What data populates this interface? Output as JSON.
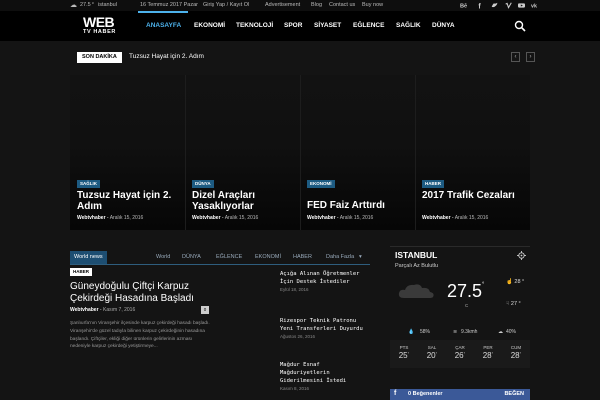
{
  "topbar": {
    "weather_temp": "27.5",
    "weather_unit": "c",
    "city": "istanbul",
    "date": "16 Temmuz 2017 Pazar",
    "links": [
      "Giriş Yap / Kayıt Ol",
      "Advertisement",
      "Blog",
      "Contact us",
      "Buy now"
    ],
    "social_icons": [
      "behance-icon",
      "facebook-icon",
      "twitter-icon",
      "vimeo-icon",
      "youtube-icon",
      "vk-icon"
    ]
  },
  "logo": {
    "line1": "WEB",
    "line2": "TV HABER"
  },
  "nav": {
    "items": [
      "ANASAYFA",
      "EKONOMİ",
      "TEKNOLOJİ",
      "SPOR",
      "SİYASET",
      "EĞLENCE",
      "SAĞLIK",
      "DÜNYA"
    ],
    "active": "ANASAYFA"
  },
  "breaking": {
    "tag": "SON DAKİKA",
    "headline": "Tuzsuz Hayat için 2. Adım",
    "prev_arrow": "‹",
    "next_arrow": "›"
  },
  "hero_tiles": [
    {
      "category": "SAĞLIK",
      "title": "Tuzsuz Hayat için 2. Adım",
      "author": "Webtvhaber",
      "date": "Aralık 15, 2016"
    },
    {
      "category": "DÜNYA",
      "title": "Dizel Araçları Yasaklıyorlar",
      "author": "Webtvhaber",
      "date": "Aralık 15, 2016"
    },
    {
      "category": "EKONOMİ",
      "title": "FED Faiz Arttırdı",
      "author": "Webtvhaber",
      "date": "Aralık 15, 2016"
    },
    {
      "category": "HABER",
      "title": "2017 Trafik Cezaları",
      "author": "Webtvhaber",
      "date": "Aralık 15, 2016"
    }
  ],
  "news_tabs": {
    "block_title": "World news",
    "tabs": [
      "World",
      "DÜNYA",
      "EĞLENCE",
      "EKONOMİ",
      "HABER",
      "Daha Fazla"
    ],
    "more_icon": "▾"
  },
  "featured": {
    "tag": "HABER",
    "title": "Güneydoğulu Çiftçi Karpuz Çekirdeği Hasadına Başladı",
    "author": "Webtvhaber",
    "separator": "-",
    "date": "Kasım 7, 2016",
    "comments": "0",
    "excerpt": "Şanlıurfa'nın Viranşehir ilçesinde karpuz çekirdeği hasadı başladı. Viranşehir'de güzel tadıyla bilinen karpuz çekirdeğinin hasadına başlandı. Çiftçiler, ekliği diğer ürünlerin gelirlerinin azması nedeniyle karpuz çekirdeği yetiştirmeye..."
  },
  "side_news": [
    {
      "title": "Açığa Alınan Öğretmenler İçin Destek İstediler",
      "date": "Eylül 18, 2016"
    },
    {
      "title": "Rizespor Teknik Patronu Yeni Transferleri Duyurdu",
      "date": "Ağustos 26, 2016"
    },
    {
      "title": "Mağdur Esnaf Mağduriyetlerin Giderilmesini İstedi",
      "date": "Kasım 8, 2016"
    }
  ],
  "weather": {
    "city": "ISTANBUL",
    "condition": "Parçalı Az Bulutlu",
    "temp": "27.5",
    "temp_deg": "°",
    "unit": "C",
    "high": "28 °",
    "low": "27 °",
    "humidity": "58%",
    "wind": "9.3kmh",
    "clouds": "40%",
    "forecast": [
      {
        "day": "PTS",
        "temp": "25",
        "deg": "°"
      },
      {
        "day": "SAL",
        "temp": "20",
        "deg": "°"
      },
      {
        "day": "ÇAR",
        "temp": "26",
        "deg": "°"
      },
      {
        "day": "PER",
        "temp": "28",
        "deg": "°"
      },
      {
        "day": "CUM",
        "temp": "28",
        "deg": "°"
      }
    ]
  },
  "facebook": {
    "count": "0",
    "label": "Beğenenler",
    "button": "BEĞEN"
  },
  "colors": {
    "accent": "#4db2ec",
    "tag_bg": "#1d5b82",
    "facebook": "#3b5998"
  }
}
